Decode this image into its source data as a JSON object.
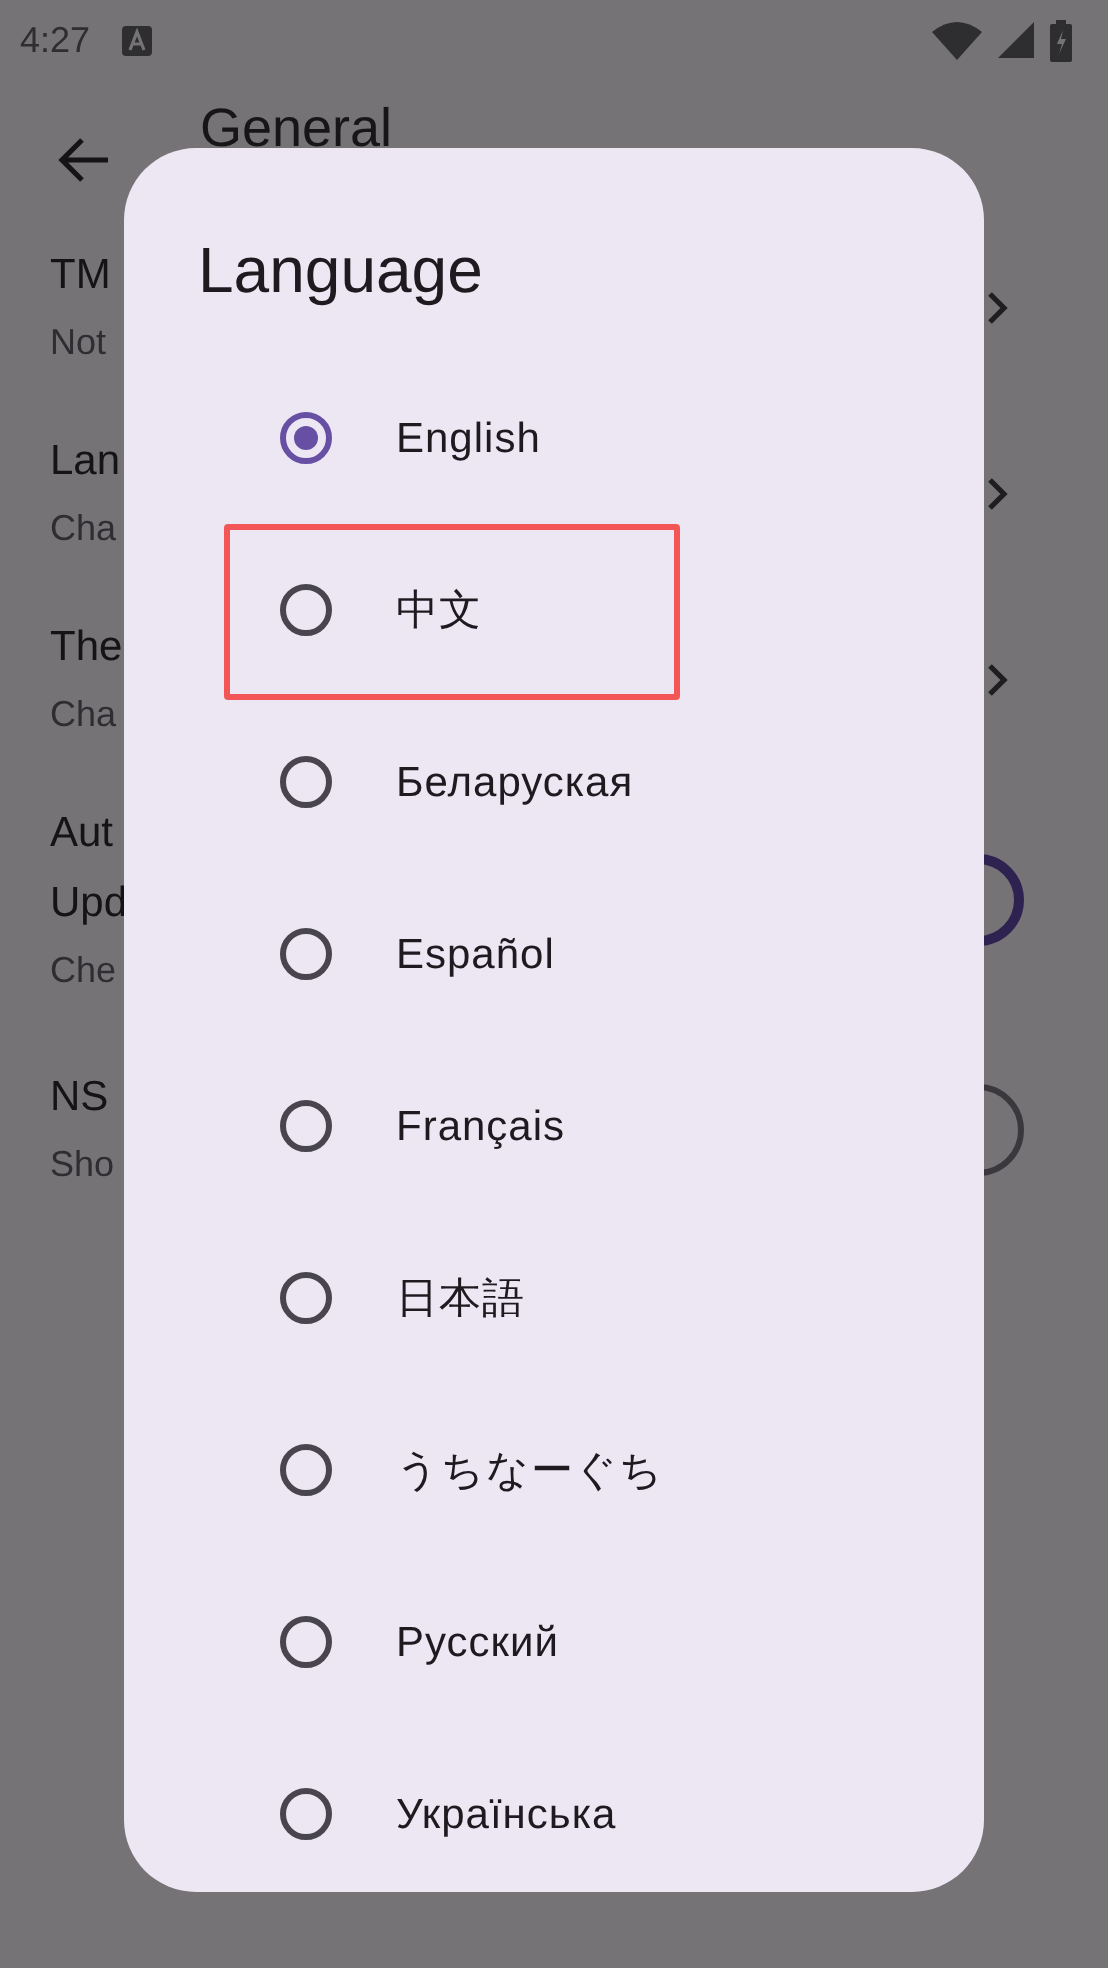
{
  "status_bar": {
    "time": "4:27"
  },
  "app_bar": {
    "title": "General"
  },
  "settings": [
    {
      "title_lines": [
        "TM"
      ],
      "subtitle": "Not",
      "kind": "chevron"
    },
    {
      "title_lines": [
        "Lan"
      ],
      "subtitle": "Cha",
      "kind": "chevron"
    },
    {
      "title_lines": [
        "The"
      ],
      "subtitle": "Cha",
      "kind": "chevron"
    },
    {
      "title_lines": [
        "Aut",
        "Upd"
      ],
      "subtitle": "Che",
      "kind": "switch",
      "on": true
    },
    {
      "title_lines": [
        "NS"
      ],
      "subtitle": "Sho",
      "kind": "switch",
      "on": false
    }
  ],
  "dialog": {
    "title": "Language",
    "options": [
      {
        "label": "English",
        "selected": true,
        "highlighted": false
      },
      {
        "label": "中文",
        "selected": false,
        "highlighted": true
      },
      {
        "label": "Беларуская",
        "selected": false,
        "highlighted": false
      },
      {
        "label": "Español",
        "selected": false,
        "highlighted": false
      },
      {
        "label": "Français",
        "selected": false,
        "highlighted": false
      },
      {
        "label": "日本語",
        "selected": false,
        "highlighted": false
      },
      {
        "label": "うちなーぐち",
        "selected": false,
        "highlighted": false
      },
      {
        "label": "Русский",
        "selected": false,
        "highlighted": false
      },
      {
        "label": "Українська",
        "selected": false,
        "highlighted": false
      }
    ]
  }
}
